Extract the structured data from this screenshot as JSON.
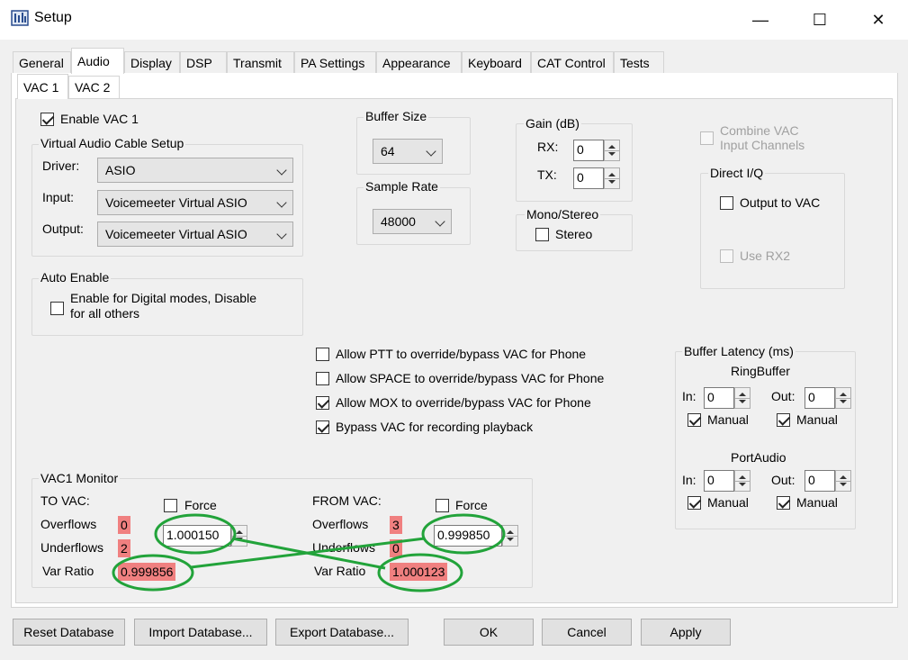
{
  "window": {
    "title": "Setup",
    "controls": {
      "minimize": "—",
      "maximize": "☐",
      "close": "✕"
    }
  },
  "tabs": [
    "General",
    "Audio",
    "Display",
    "DSP",
    "Transmit",
    "PA Settings",
    "Appearance",
    "Keyboard",
    "CAT Control",
    "Tests"
  ],
  "active_tab": "Audio",
  "subtabs": [
    "VAC 1",
    "VAC 2"
  ],
  "active_subtab": "VAC 1",
  "enable_vac": {
    "label": "Enable VAC 1",
    "checked": true
  },
  "vac_setup": {
    "legend": "Virtual Audio Cable Setup",
    "driver": {
      "label": "Driver:",
      "value": "ASIO"
    },
    "input": {
      "label": "Input:",
      "value": "Voicemeeter Virtual ASIO"
    },
    "output": {
      "label": "Output:",
      "value": "Voicemeeter Virtual ASIO"
    }
  },
  "auto_enable": {
    "legend": "Auto Enable",
    "line1": "Enable for Digital modes, Disable",
    "line2": "for all others",
    "checked": false
  },
  "buffer_size": {
    "legend": "Buffer Size",
    "value": "64"
  },
  "sample_rate": {
    "legend": "Sample Rate",
    "value": "48000"
  },
  "gain": {
    "legend": "Gain (dB)",
    "rx": {
      "label": "RX:",
      "value": "0"
    },
    "tx": {
      "label": "TX:",
      "value": "0"
    }
  },
  "mono_stereo": {
    "legend": "Mono/Stereo",
    "stereo_label": "Stereo",
    "checked": false
  },
  "combine": {
    "line1": "Combine VAC",
    "line2": "Input Channels",
    "enabled": false
  },
  "direct_iq": {
    "legend": "Direct I/Q",
    "output_to_vac": "Output to VAC",
    "use_rx2": "Use RX2"
  },
  "options": [
    {
      "label": "Allow PTT to override/bypass VAC for Phone",
      "checked": false
    },
    {
      "label": "Allow SPACE to override/bypass VAC for Phone",
      "checked": false
    },
    {
      "label": "Allow MOX to override/bypass VAC for Phone",
      "checked": true
    },
    {
      "label": "Bypass VAC for recording playback",
      "checked": true
    }
  ],
  "buffer_latency": {
    "legend": "Buffer Latency (ms)",
    "ringbuffer": {
      "title": "RingBuffer",
      "in_label": "In:",
      "in_value": "0",
      "out_label": "Out:",
      "out_value": "0",
      "manual_label": "Manual"
    },
    "portaudio": {
      "title": "PortAudio",
      "in_label": "In:",
      "in_value": "0",
      "out_label": "Out:",
      "out_value": "0",
      "manual_label": "Manual"
    }
  },
  "monitor": {
    "legend": "VAC1 Monitor",
    "to_vac": {
      "title": "TO VAC:",
      "force": "Force",
      "overflows_label": "Overflows",
      "overflows": "0",
      "underflows_label": "Underflows",
      "underflows": "2",
      "var_ratio_label": "Var Ratio",
      "var_ratio": "0.999856",
      "spin_value": "1.000150"
    },
    "from_vac": {
      "title": "FROM VAC:",
      "force": "Force",
      "overflows_label": "Overflows",
      "overflows": "3",
      "underflows_label": "Underflows",
      "underflows": "0",
      "var_ratio_label": "Var Ratio",
      "var_ratio": "1.000123",
      "spin_value": "0.999850"
    }
  },
  "annotation_color": "#22a33a",
  "buttons": {
    "reset": "Reset Database",
    "import": "Import Database...",
    "export": "Export Database...",
    "ok": "OK",
    "cancel": "Cancel",
    "apply": "Apply"
  }
}
